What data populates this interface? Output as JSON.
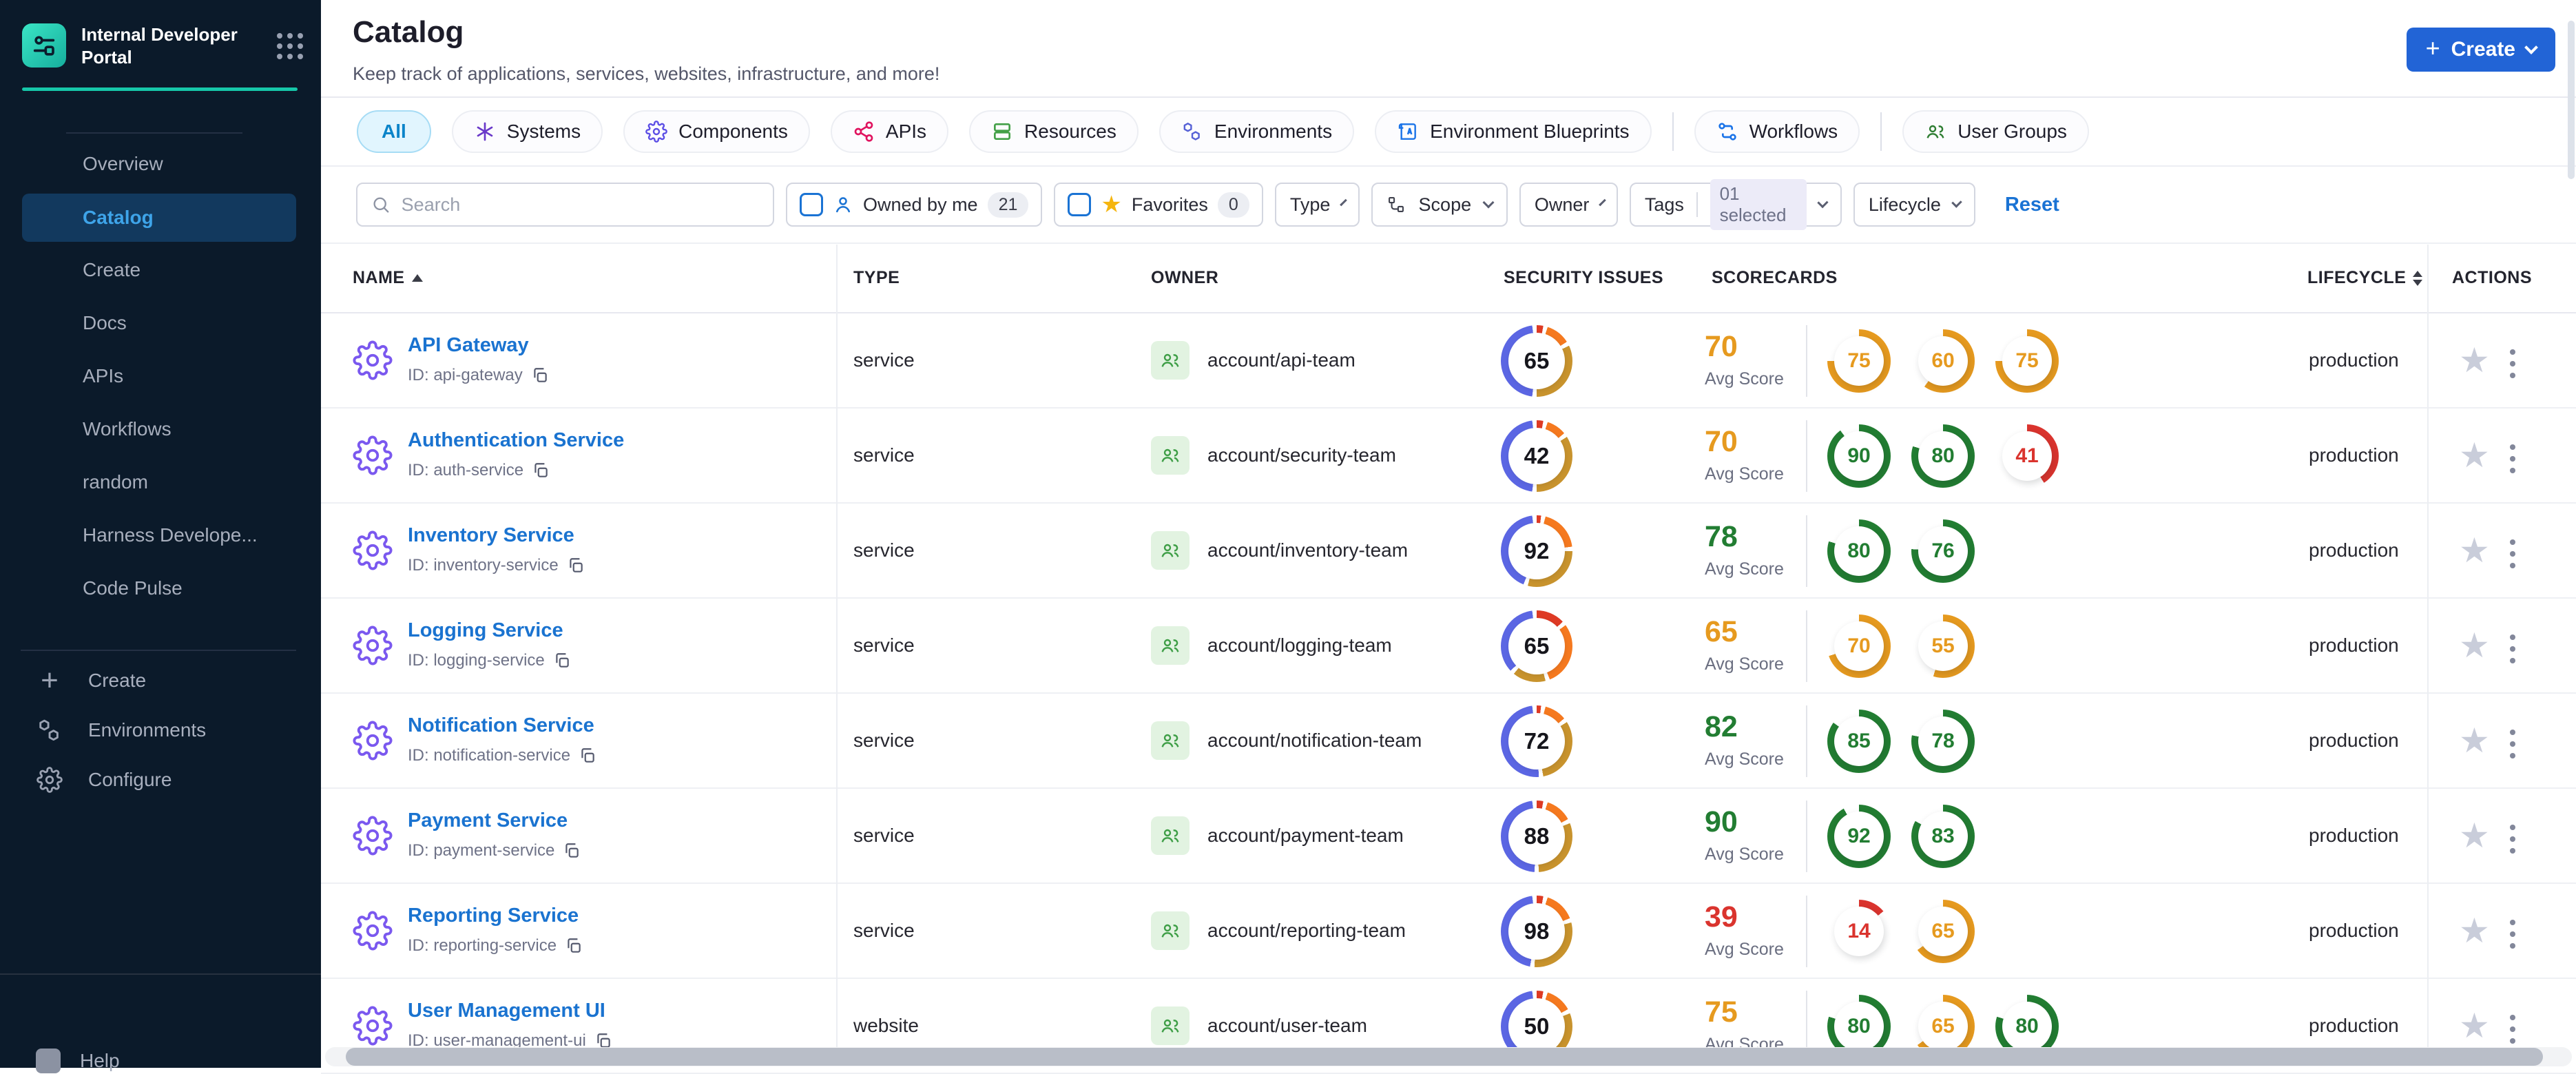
{
  "sidebar": {
    "brand_title": "Internal Developer Portal",
    "nav": [
      "Overview",
      "Catalog",
      "Create",
      "Docs",
      "APIs",
      "Workflows",
      "random",
      "Harness Develope...",
      "Code Pulse"
    ],
    "bottom": [
      {
        "icon": "plus-icon",
        "label": "Create"
      },
      {
        "icon": "hexagons-icon",
        "label": "Environments"
      },
      {
        "icon": "gear-icon",
        "label": "Configure"
      }
    ],
    "help": "Help"
  },
  "header": {
    "title": "Catalog",
    "subtitle": "Keep track of applications, services, websites, infrastructure, and more!",
    "create_label": "Create"
  },
  "tabs": [
    {
      "label": "All",
      "active": true
    },
    {
      "label": "Systems",
      "icon": "systems-icon",
      "color": "#6938c9"
    },
    {
      "label": "Components",
      "icon": "components-gear-icon",
      "color": "#5c4ee5"
    },
    {
      "label": "APIs",
      "icon": "api-nodes-icon",
      "color": "#e0145f"
    },
    {
      "label": "Resources",
      "icon": "resources-stack-icon",
      "color": "#43a047"
    },
    {
      "label": "Environments",
      "icon": "hexagons-icon",
      "color": "#5661d6"
    },
    {
      "label": "Environment Blueprints",
      "icon": "blueprint-icon",
      "color": "#1a73e8"
    },
    {
      "label": "Workflows",
      "icon": "workflow-icon",
      "color": "#1a73e8"
    },
    {
      "label": "User Groups",
      "icon": "user-groups-icon",
      "color": "#2e7d32"
    }
  ],
  "filters": {
    "search_placeholder": "Search",
    "owned": {
      "label": "Owned by me",
      "count": "21"
    },
    "favorites": {
      "label": "Favorites",
      "count": "0"
    },
    "type": "Type",
    "scope": "Scope",
    "owner": "Owner",
    "tags_label": "Tags",
    "tags_value": "01 selected",
    "lifecycle": "Lifecycle",
    "reset": "Reset"
  },
  "table": {
    "columns": [
      "NAME",
      "TYPE",
      "OWNER",
      "SECURITY ISSUES",
      "SCORECARDS",
      "LIFECYCLE",
      "ACTIONS"
    ],
    "avg_label": "Avg Score",
    "rows": [
      {
        "name": "API Gateway",
        "id": "ID: api-gateway",
        "type": "service",
        "owner": "account/api-team",
        "security": {
          "value": "65",
          "segments": [
            3,
            11,
            32,
            46
          ]
        },
        "avg": {
          "value": "70",
          "level": "mid"
        },
        "scores": [
          {
            "v": 75,
            "level": "mid"
          },
          {
            "v": 60,
            "level": "mid"
          },
          {
            "v": 75,
            "level": "mid"
          }
        ],
        "lifecycle": "production"
      },
      {
        "name": "Authentication Service",
        "id": "ID: auth-service",
        "type": "service",
        "owner": "account/security-team",
        "security": {
          "value": "42",
          "segments": [
            3,
            9,
            34,
            46
          ]
        },
        "avg": {
          "value": "70",
          "level": "mid"
        },
        "scores": [
          {
            "v": 90,
            "level": "high"
          },
          {
            "v": 80,
            "level": "high"
          },
          {
            "v": 41,
            "level": "low"
          }
        ],
        "lifecycle": "production"
      },
      {
        "name": "Inventory Service",
        "id": "ID: inventory-service",
        "type": "service",
        "owner": "account/inventory-team",
        "security": {
          "value": "92",
          "segments": [
            2,
            19,
            29,
            42
          ]
        },
        "avg": {
          "value": "78",
          "level": "high"
        },
        "scores": [
          {
            "v": 80,
            "level": "high"
          },
          {
            "v": 76,
            "level": "high"
          }
        ],
        "lifecycle": "production"
      },
      {
        "name": "Logging Service",
        "id": "ID: logging-service",
        "type": "service",
        "owner": "account/logging-team",
        "security": {
          "value": "65",
          "segments": [
            13,
            29,
            15,
            35
          ]
        },
        "avg": {
          "value": "65",
          "level": "mid"
        },
        "scores": [
          {
            "v": 70,
            "level": "mid"
          },
          {
            "v": 55,
            "level": "mid"
          }
        ],
        "lifecycle": "production"
      },
      {
        "name": "Notification Service",
        "id": "ID: notification-service",
        "type": "service",
        "owner": "account/notification-team",
        "security": {
          "value": "72",
          "segments": [
            2,
            10,
            31,
            49
          ]
        },
        "avg": {
          "value": "82",
          "level": "high"
        },
        "scores": [
          {
            "v": 85,
            "level": "high"
          },
          {
            "v": 78,
            "level": "high"
          }
        ],
        "lifecycle": "production"
      },
      {
        "name": "Payment Service",
        "id": "ID: payment-service",
        "type": "service",
        "owner": "account/payment-team",
        "security": {
          "value": "88",
          "segments": [
            3,
            12,
            30,
            47
          ]
        },
        "avg": {
          "value": "90",
          "level": "high"
        },
        "scores": [
          {
            "v": 92,
            "level": "high"
          },
          {
            "v": 83,
            "level": "high"
          }
        ],
        "lifecycle": "production"
      },
      {
        "name": "Reporting Service",
        "id": "ID: reporting-service",
        "type": "service",
        "owner": "account/reporting-team",
        "security": {
          "value": "98",
          "segments": [
            3,
            14,
            30,
            45
          ]
        },
        "avg": {
          "value": "39",
          "level": "low"
        },
        "scores": [
          {
            "v": 14,
            "level": "low"
          },
          {
            "v": 65,
            "level": "mid"
          }
        ],
        "lifecycle": "production"
      },
      {
        "name": "User Management UI",
        "id": "ID: user-management-ui",
        "type": "website",
        "owner": "account/user-team",
        "security": {
          "value": "50",
          "segments": [
            3,
            12,
            33,
            44
          ]
        },
        "avg": {
          "value": "75",
          "level": "mid"
        },
        "scores": [
          {
            "v": 80,
            "level": "high"
          },
          {
            "v": 65,
            "level": "mid"
          },
          {
            "v": 80,
            "level": "high"
          }
        ],
        "lifecycle": "production"
      }
    ]
  },
  "colors": {
    "level_high": "#227d32",
    "level_mid": "#e69a1f",
    "level_low": "#da342e",
    "donut_red": "#de3a24",
    "donut_orange": "#f5791f",
    "donut_gold": "#c8932d",
    "donut_blue": "#5b66e3",
    "accent_teal": "#16c7a9",
    "link_blue": "#1a73d0",
    "primary_blue": "#2264d6"
  }
}
